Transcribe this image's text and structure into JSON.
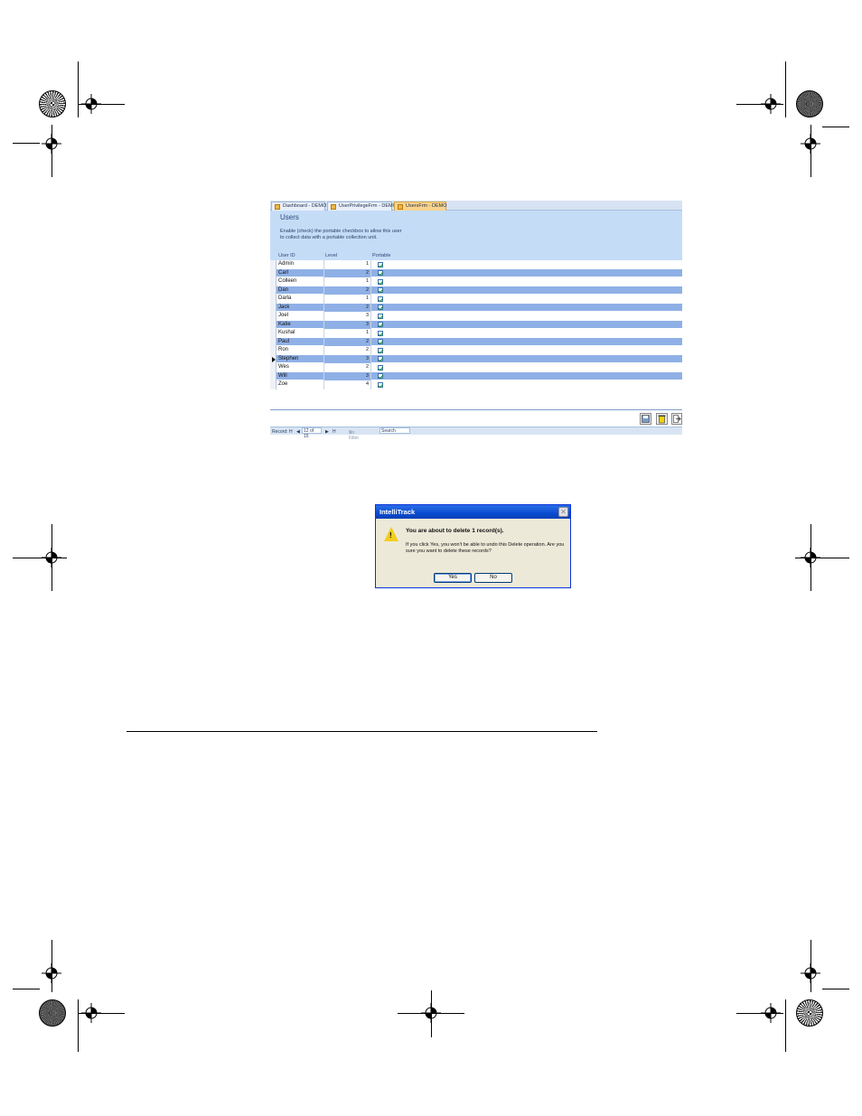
{
  "access": {
    "tabs": [
      {
        "label": "Dashboard - DEMO"
      },
      {
        "label": "UserPrivilegeFrm - DEMO"
      },
      {
        "label": "UsersFrm - DEMO"
      }
    ],
    "form_title": "Users",
    "help_text": "Enable (check) the portable checkbox to allow this user to collect data with a portable collection unit.",
    "columns": {
      "user_id": "User ID",
      "level": "Level",
      "portable": "Portable"
    },
    "rows": [
      {
        "user": "Admin",
        "level": "1",
        "portable": true
      },
      {
        "user": "Carl",
        "level": "2",
        "portable": true
      },
      {
        "user": "Colleen",
        "level": "1",
        "portable": true
      },
      {
        "user": "Dan",
        "level": "2",
        "portable": true
      },
      {
        "user": "Darla",
        "level": "1",
        "portable": true
      },
      {
        "user": "Jack",
        "level": "2",
        "portable": true
      },
      {
        "user": "Joel",
        "level": "3",
        "portable": true
      },
      {
        "user": "Katie",
        "level": "3",
        "portable": true
      },
      {
        "user": "Kushal",
        "level": "1",
        "portable": true
      },
      {
        "user": "Paul",
        "level": "2",
        "portable": true
      },
      {
        "user": "Ron",
        "level": "2",
        "portable": true
      },
      {
        "user": "Stephen",
        "level": "3",
        "portable": true
      },
      {
        "user": "Wes",
        "level": "2",
        "portable": true
      },
      {
        "user": "Will",
        "level": "3",
        "portable": true
      },
      {
        "user": "Zoe",
        "level": "4",
        "portable": true
      }
    ],
    "navigation": {
      "record_label": "Record:",
      "first": "H",
      "prev": "◀",
      "position": "12 of 15",
      "next": "▶",
      "last": "H",
      "filter": "No Filter",
      "search": "Search"
    }
  },
  "dialog": {
    "title": "IntelliTrack",
    "heading": "You are about to delete 1 record(s).",
    "body": "If you click Yes, you won't be able to undo this Delete operation. Are you sure you want to delete these records?",
    "yes": "Yes",
    "no": "No",
    "close": "✕"
  }
}
